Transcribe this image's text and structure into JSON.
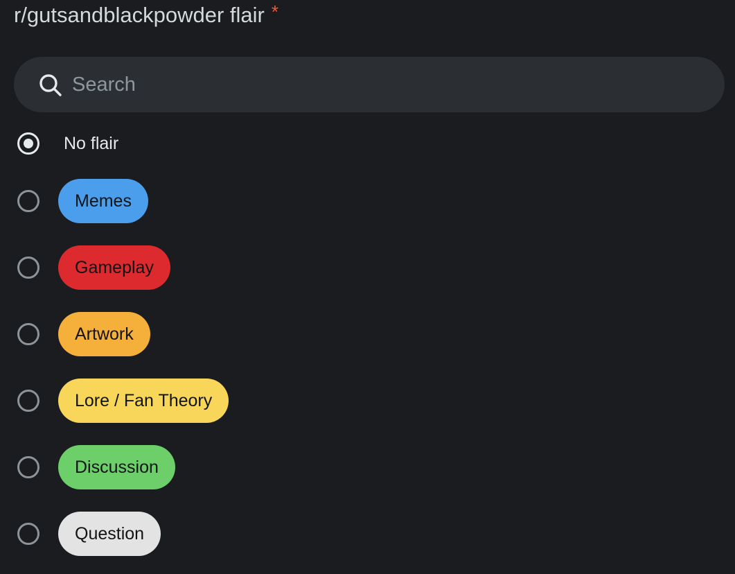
{
  "header": {
    "title": "r/gutsandblackpowder flair",
    "required_marker": "*"
  },
  "search": {
    "placeholder": "Search",
    "value": "",
    "icon": "search-icon"
  },
  "options": [
    {
      "label": "No flair",
      "selected": true,
      "color": null
    },
    {
      "label": "Memes",
      "selected": false,
      "color": "#4a9eeb"
    },
    {
      "label": "Gameplay",
      "selected": false,
      "color": "#dd2a2f"
    },
    {
      "label": "Artwork",
      "selected": false,
      "color": "#f4b03b"
    },
    {
      "label": "Lore / Fan Theory",
      "selected": false,
      "color": "#f8d65a"
    },
    {
      "label": "Discussion",
      "selected": false,
      "color": "#6ccf6a"
    },
    {
      "label": "Question",
      "selected": false,
      "color": "#e3e3e3"
    }
  ],
  "colors": {
    "background": "#1a1c1f",
    "search_background": "#2b2f33",
    "required": "#ee5a3a"
  }
}
